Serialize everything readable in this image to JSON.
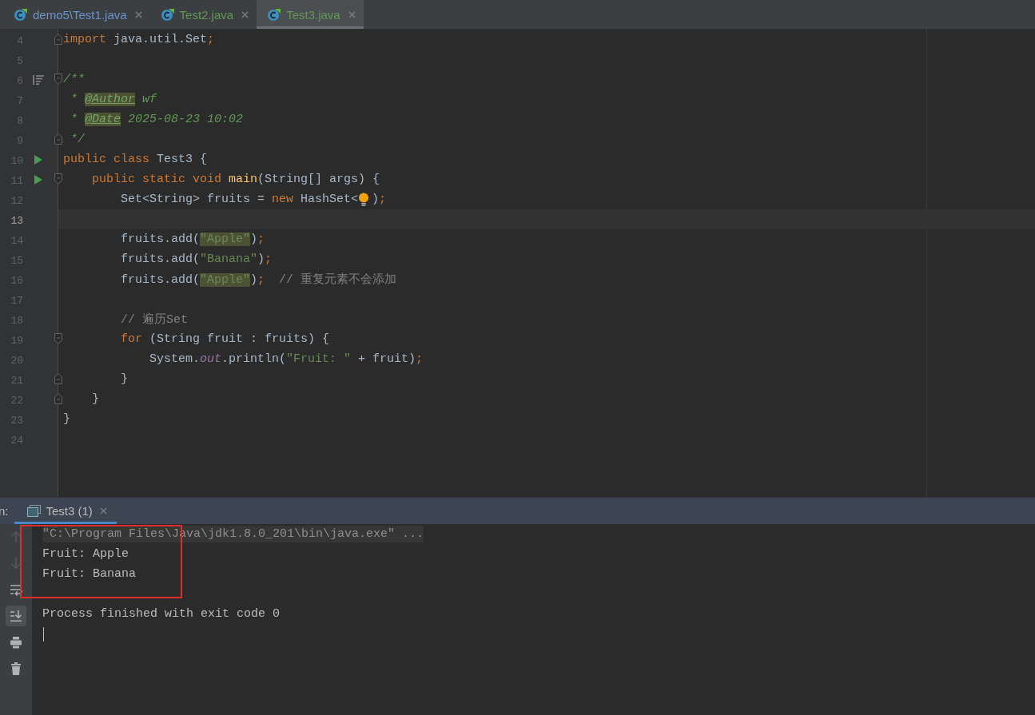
{
  "tabs": [
    {
      "label": "demo5\\Test1.java",
      "color": "#6a93cc",
      "selected": false
    },
    {
      "label": "Test2.java",
      "color": "#629755",
      "selected": false
    },
    {
      "label": "Test3.java",
      "color": "#629755",
      "selected": true
    }
  ],
  "editor": {
    "lines": [
      {
        "number": "4",
        "current": false,
        "gutter": [
          {
            "kind": "fold-end"
          }
        ],
        "tokens": [
          {
            "kind": "keyword",
            "text": "import",
            "highlighted": false
          },
          {
            "kind": "plain",
            "text": " java.util.Set",
            "highlighted": false
          },
          {
            "kind": "punct",
            "text": ";",
            "highlighted": false
          }
        ]
      },
      {
        "number": "5",
        "current": false
      },
      {
        "number": "6",
        "current": false,
        "gutter": [
          {
            "kind": "doc"
          },
          {
            "kind": "fold-start"
          }
        ],
        "tokens": [
          {
            "kind": "doc",
            "text": "/**",
            "highlighted": false
          }
        ]
      },
      {
        "number": "7",
        "current": false,
        "tokens": [
          {
            "kind": "doc",
            "text": " * ",
            "highlighted": false
          },
          {
            "kind": "doc-tag",
            "text": "@Author",
            "highlighted": true
          },
          {
            "kind": "doc",
            "text": " wf",
            "highlighted": false
          }
        ]
      },
      {
        "number": "8",
        "current": false,
        "tokens": [
          {
            "kind": "doc",
            "text": " * ",
            "highlighted": false
          },
          {
            "kind": "doc-tag",
            "text": "@Date",
            "highlighted": true
          },
          {
            "kind": "doc",
            "text": " 2025-08-23 10:02",
            "highlighted": false
          }
        ]
      },
      {
        "number": "9",
        "current": false,
        "gutter": [
          {
            "kind": "fold-end"
          }
        ],
        "tokens": [
          {
            "kind": "doc",
            "text": " */",
            "highlighted": false
          }
        ]
      },
      {
        "number": "10",
        "current": false,
        "gutter": [
          {
            "kind": "run"
          }
        ],
        "tokens": [
          {
            "kind": "keyword",
            "text": "public class",
            "highlighted": false
          },
          {
            "kind": "plain",
            "text": " Test3 {",
            "highlighted": false
          }
        ]
      },
      {
        "number": "11",
        "current": false,
        "gutter": [
          {
            "kind": "run"
          },
          {
            "kind": "fold-start"
          }
        ],
        "tokens": [
          {
            "kind": "keyword",
            "text": "    public static void ",
            "highlighted": false
          },
          {
            "kind": "method",
            "text": "main",
            "highlighted": false
          },
          {
            "kind": "plain",
            "text": "(String[] args) {",
            "highlighted": false
          }
        ]
      },
      {
        "number": "12",
        "current": false,
        "tokens": [
          {
            "kind": "plain",
            "text": "        Set<String> fruits = ",
            "highlighted": false
          },
          {
            "kind": "keyword",
            "text": "new",
            "highlighted": false
          },
          {
            "kind": "plain",
            "text": " HashSet<",
            "highlighted": false
          },
          {
            "kind": "bulb"
          },
          {
            "kind": "plain",
            "text": ")",
            "highlighted": false
          },
          {
            "kind": "punct",
            "text": ";",
            "highlighted": false
          }
        ]
      },
      {
        "number": "13",
        "current": true
      },
      {
        "number": "14",
        "current": false,
        "tokens": [
          {
            "kind": "plain",
            "text": "        fruits.add(",
            "highlighted": false
          },
          {
            "kind": "string",
            "text": "\"Apple\"",
            "highlighted": true
          },
          {
            "kind": "plain",
            "text": ")",
            "highlighted": false
          },
          {
            "kind": "punct",
            "text": ";",
            "highlighted": false
          }
        ]
      },
      {
        "number": "15",
        "current": false,
        "tokens": [
          {
            "kind": "plain",
            "text": "        fruits.add(",
            "highlighted": false
          },
          {
            "kind": "string",
            "text": "\"Banana\"",
            "highlighted": false
          },
          {
            "kind": "plain",
            "text": ")",
            "highlighted": false
          },
          {
            "kind": "punct",
            "text": ";",
            "highlighted": false
          }
        ]
      },
      {
        "number": "16",
        "current": false,
        "tokens": [
          {
            "kind": "plain",
            "text": "        fruits.add(",
            "highlighted": false
          },
          {
            "kind": "string",
            "text": "\"Apple\"",
            "highlighted": true
          },
          {
            "kind": "plain",
            "text": ")",
            "highlighted": false
          },
          {
            "kind": "punct",
            "text": ";",
            "highlighted": false
          },
          {
            "kind": "comment",
            "text": "  // 重复元素不会添加",
            "highlighted": false
          }
        ]
      },
      {
        "number": "17",
        "current": false
      },
      {
        "number": "18",
        "current": false,
        "tokens": [
          {
            "kind": "comment",
            "text": "        // 遍历Set",
            "highlighted": false
          }
        ]
      },
      {
        "number": "19",
        "current": false,
        "gutter": [
          {
            "kind": "fold-start"
          }
        ],
        "tokens": [
          {
            "kind": "keyword",
            "text": "        for",
            "highlighted": false
          },
          {
            "kind": "plain",
            "text": " (String fruit : fruits) {",
            "highlighted": false
          }
        ]
      },
      {
        "number": "20",
        "current": false,
        "tokens": [
          {
            "kind": "plain",
            "text": "            System.",
            "highlighted": false
          },
          {
            "kind": "field",
            "text": "out",
            "highlighted": false
          },
          {
            "kind": "plain",
            "text": ".println(",
            "highlighted": false
          },
          {
            "kind": "string",
            "text": "\"Fruit: \"",
            "highlighted": false
          },
          {
            "kind": "plain",
            "text": " + fruit)",
            "highlighted": false
          },
          {
            "kind": "punct",
            "text": ";",
            "highlighted": false
          }
        ]
      },
      {
        "number": "21",
        "current": false,
        "gutter": [
          {
            "kind": "fold-end"
          }
        ],
        "tokens": [
          {
            "kind": "plain",
            "text": "        }",
            "highlighted": false
          }
        ]
      },
      {
        "number": "22",
        "current": false,
        "gutter": [
          {
            "kind": "fold-end"
          }
        ],
        "tokens": [
          {
            "kind": "plain",
            "text": "    }",
            "highlighted": false
          }
        ]
      },
      {
        "number": "23",
        "current": false,
        "tokens": [
          {
            "kind": "plain",
            "text": "}",
            "highlighted": false
          }
        ]
      },
      {
        "number": "24",
        "current": false
      }
    ]
  },
  "run_panel": {
    "label": "n:",
    "tab": {
      "label": "Test3 (1)",
      "selected": true
    },
    "toolbar": [
      {
        "kind": "up-arrow",
        "disabled": true,
        "selected": false
      },
      {
        "kind": "down-arrow",
        "disabled": true,
        "selected": false
      },
      {
        "kind": "soft-wrap",
        "disabled": false,
        "selected": false
      },
      {
        "kind": "scroll-to-end",
        "disabled": false,
        "selected": true
      },
      {
        "kind": "print",
        "disabled": false,
        "selected": false
      },
      {
        "kind": "trash",
        "disabled": false,
        "selected": false
      }
    ],
    "console": [
      {
        "kind": "command",
        "text": "\"C:\\Program Files\\Java\\jdk1.8.0_201\\bin\\java.exe\" ..."
      },
      {
        "kind": "output",
        "text": "Fruit: Apple"
      },
      {
        "kind": "output",
        "text": "Fruit: Banana"
      },
      {
        "kind": "blank"
      },
      {
        "kind": "output",
        "text": "Process finished with exit code 0"
      },
      {
        "kind": "caret"
      }
    ]
  },
  "annotation": {
    "kind": "rectangle"
  }
}
